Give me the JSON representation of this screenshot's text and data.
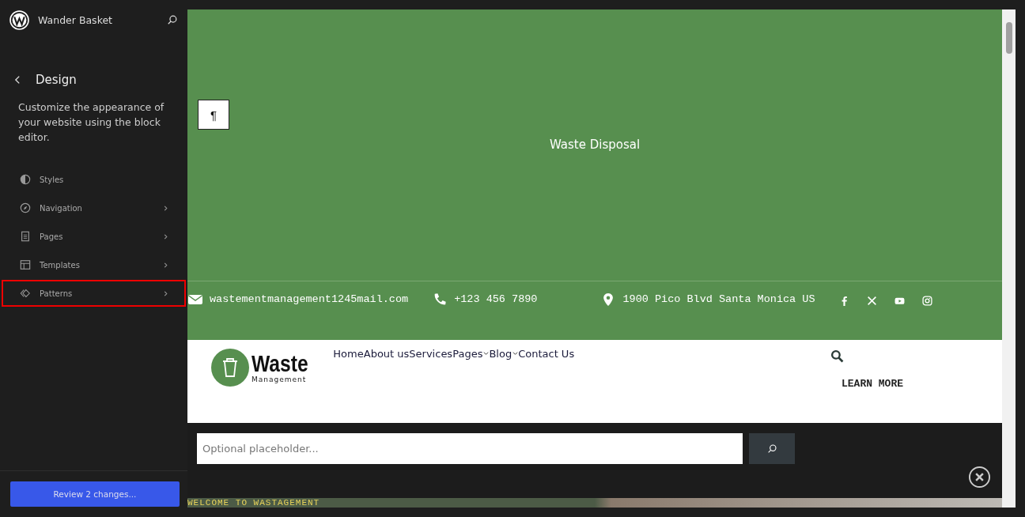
{
  "site": {
    "title": "Wander Basket"
  },
  "panel": {
    "heading": "Design",
    "description": "Customize the appearance of your website using the block editor.",
    "items": [
      {
        "label": "Styles",
        "chevron": false,
        "selected": false
      },
      {
        "label": "Navigation",
        "chevron": true,
        "selected": false
      },
      {
        "label": "Pages",
        "chevron": true,
        "selected": false
      },
      {
        "label": "Templates",
        "chevron": true,
        "selected": false
      },
      {
        "label": "Patterns",
        "chevron": true,
        "selected": true
      }
    ],
    "review_button": "Review 2 changes..."
  },
  "preview": {
    "paragraph_button": "¶",
    "hero_title": "Waste Disposal",
    "contacts": [
      {
        "kind": "email",
        "text": "wastementmanagement1245mail.com"
      },
      {
        "kind": "phone",
        "text": "+123 456 7890"
      },
      {
        "kind": "pin",
        "text": "1900 Pico Blvd Santa Monica US"
      }
    ],
    "logo": {
      "name": "Waste",
      "tagline": "Management"
    },
    "menu": [
      {
        "label": "Home",
        "dropdown": false
      },
      {
        "label": "About us",
        "dropdown": false
      },
      {
        "label": "Services",
        "dropdown": false
      },
      {
        "label": "Pages",
        "dropdown": true
      },
      {
        "label": "Blog",
        "dropdown": true
      },
      {
        "label": "Contact Us",
        "dropdown": false
      }
    ],
    "cta": "LEARN MORE",
    "search": {
      "placeholder": "Optional placeholder..."
    },
    "banner_text": "WELCOME TO WASTAGEMENT"
  }
}
